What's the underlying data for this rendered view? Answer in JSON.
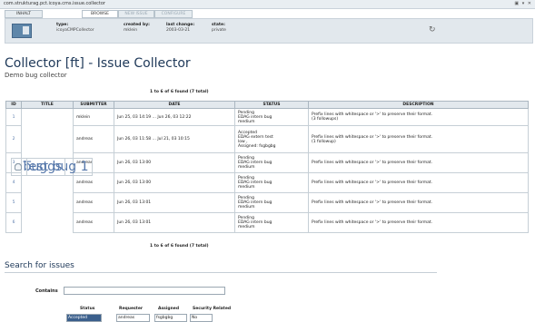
{
  "window": {
    "path": "com.strukturag.pct.icoya.cms.issue.collector",
    "controls": "▣ ▾ ✕"
  },
  "tabs": [
    {
      "label": "INHALT"
    },
    {
      "label": "BROWSE"
    },
    {
      "label": "NEW ISSUE"
    },
    {
      "label": "CONFIGURE"
    }
  ],
  "info": {
    "type_label": "type:",
    "type_value": "icoyaCMPCollector",
    "created_label": "created by:",
    "created_value": "mklein",
    "change_label": "last change:",
    "change_value": "2003-03-21",
    "state_label": "state:",
    "state_value": "private"
  },
  "page": {
    "title": "Collector [ft] - Issue Collector",
    "subtitle": "Demo bug collector"
  },
  "found_text": "1 to 6 of 6 found (7 total)",
  "columns": [
    "ID",
    "TITLE",
    "SUBMITTER",
    "DATE",
    "STATUS",
    "DESCRIPTION"
  ],
  "rows": [
    {
      "id": "1",
      "title": "Test bug 1",
      "submitter": "mklein",
      "date": "Jun 25, 03 14:19 ... Jun 26, 03 12:22",
      "status": [
        "Pending",
        "EDAG intern bug",
        "medium"
      ],
      "description": [
        "Prefix lines with whitespace or '>' to preserve their format.",
        "(3 followups)"
      ]
    },
    {
      "id": "2",
      "title": "buggs",
      "submitter": "andreas",
      "date": "Jun 26, 03 11:58 ... Jul 21, 03 10:15",
      "status": [
        "Accepted",
        "EDAG extern test",
        "low ,",
        "Assigned: fsgbgbg"
      ],
      "description": [
        "Prefix lines with whitespace or '>' to preserve their format.",
        "(1 followup)"
      ]
    },
    {
      "id": "3",
      "title": "",
      "submitter": "andreas",
      "date": "Jun 26, 03 13:00",
      "status": [
        "Pending",
        "EDAG intern bug",
        "medium"
      ],
      "description": [
        "Prefix lines with whitespace or '>' to preserve their format.",
        ""
      ]
    },
    {
      "id": "4",
      "title": "",
      "submitter": "andreas",
      "date": "Jun 26, 03 13:00",
      "status": [
        "Pending",
        "EDAG intern bug",
        "medium"
      ],
      "description": [
        "Prefix lines with whitespace or '>' to preserve their format.",
        ""
      ]
    },
    {
      "id": "5",
      "title": "",
      "submitter": "andreas",
      "date": "Jun 26, 03 13:01",
      "status": [
        "Pending",
        "EDAG intern bug",
        "medium"
      ],
      "description": [
        "Prefix lines with whitespace or '>' to preserve their format.",
        ""
      ]
    },
    {
      "id": "6",
      "title": "",
      "submitter": "andreas",
      "date": "Jun 26, 03 13:01",
      "status": [
        "Pending",
        "EDAG intern bug",
        "medium"
      ],
      "description": [
        "Prefix lines with whitespace or '>' to preserve their format.",
        ""
      ]
    }
  ],
  "search": {
    "heading": "Search for issues",
    "contains_label": "Contains",
    "contains_value": "",
    "status_label": "Status",
    "status_value": "Accepted",
    "requester_label": "Requester",
    "requester_value": "andreas",
    "assigned_label": "Assigned",
    "assigned_value": "fsgbgbg",
    "security_label": "Security Related",
    "security_value": "No"
  }
}
